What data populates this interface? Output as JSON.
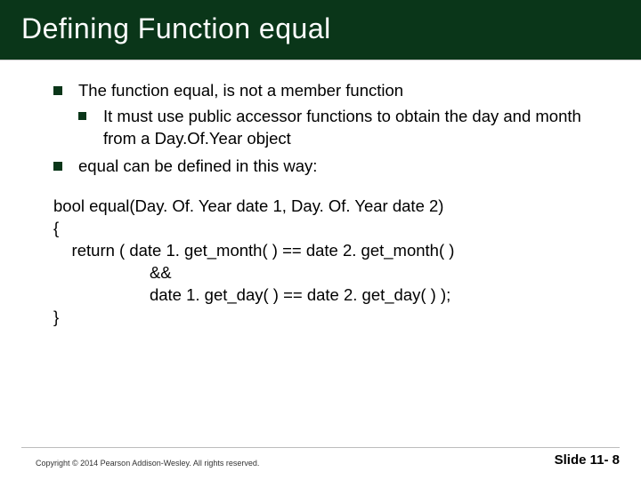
{
  "title": "Defining Function equal",
  "bullets": {
    "b1": "The function equal, is not a member function",
    "b1_1": "It must use public accessor functions to obtain the day and month from a Day.Of.Year object",
    "b2": "equal can be defined in this way:"
  },
  "code": {
    "l1": "bool equal(Day. Of. Year date 1, Day. Of. Year date 2)",
    "l2": "{",
    "l3": "    return ( date 1. get_month( ) == date 2. get_month( )",
    "l4": "                     &&",
    "l5": "                     date 1. get_day( ) == date 2. get_day( ) );",
    "l6": "}"
  },
  "footer": {
    "copyright": "Copyright © 2014 Pearson Addison-Wesley.  All rights reserved.",
    "slidenum": "Slide 11- 8"
  }
}
